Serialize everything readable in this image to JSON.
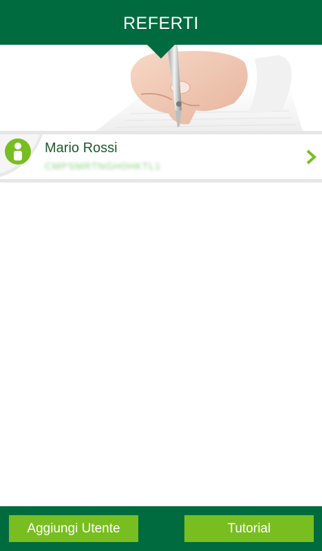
{
  "header": {
    "title": "REFERTI"
  },
  "banner": {
    "image": "hand-writing-with-pen"
  },
  "users": [
    {
      "name": "Mario Rossi",
      "fiscal_code": "CMPSMRTNGH0HKTL1"
    }
  ],
  "footer": {
    "add_user_label": "Aggiungi Utente",
    "tutorial_label": "Tutorial"
  },
  "colors": {
    "primary": "#006b3f",
    "accent": "#78be20",
    "name_text": "#1e5a2e"
  },
  "icons": {
    "avatar": "user-icon",
    "row_action": "chevron-right-icon"
  }
}
